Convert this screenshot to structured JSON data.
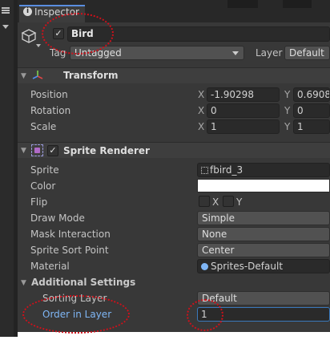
{
  "window": {
    "tab_title": "Inspector"
  },
  "gameobject": {
    "name": "Bird",
    "tag_label": "Tag",
    "tag_value": "Untagged",
    "layer_label": "Layer",
    "layer_value": "Default"
  },
  "transform": {
    "title": "Transform",
    "rows": [
      {
        "label": "Position",
        "x": "-1.90298",
        "y": "0.69080"
      },
      {
        "label": "Rotation",
        "x": "0",
        "y": "0"
      },
      {
        "label": "Scale",
        "x": "1",
        "y": "1"
      }
    ],
    "axis_x": "X",
    "axis_y": "Y"
  },
  "sprite_renderer": {
    "title": "Sprite Renderer",
    "labels": {
      "sprite": "Sprite",
      "color": "Color",
      "flip": "Flip",
      "draw_mode": "Draw Mode",
      "mask_interaction": "Mask Interaction",
      "sprite_sort_point": "Sprite Sort Point",
      "material": "Material"
    },
    "values": {
      "sprite": "fbird_3",
      "color": "#ffffff",
      "flip_x": "X",
      "flip_y": "Y",
      "draw_mode": "Simple",
      "mask_interaction": "None",
      "sprite_sort_point": "Center",
      "material": "Sprites-Default"
    },
    "additional": {
      "title": "Additional Settings",
      "sorting_layer_label": "Sorting Layer",
      "sorting_layer_value": "Default",
      "order_label": "Order in Layer",
      "order_value": "1"
    }
  },
  "colors": {
    "panel_bg": "#383838",
    "accent_blue": "#7fb6f5",
    "annotation_red": "#d0101a"
  },
  "icons": [
    "hamburger-icon",
    "info-icon",
    "cube-icon",
    "transform-axes-icon",
    "sprite-renderer-icon",
    "sprite-asset-icon",
    "material-sphere-icon",
    "dropdown-arrow-icon"
  ]
}
